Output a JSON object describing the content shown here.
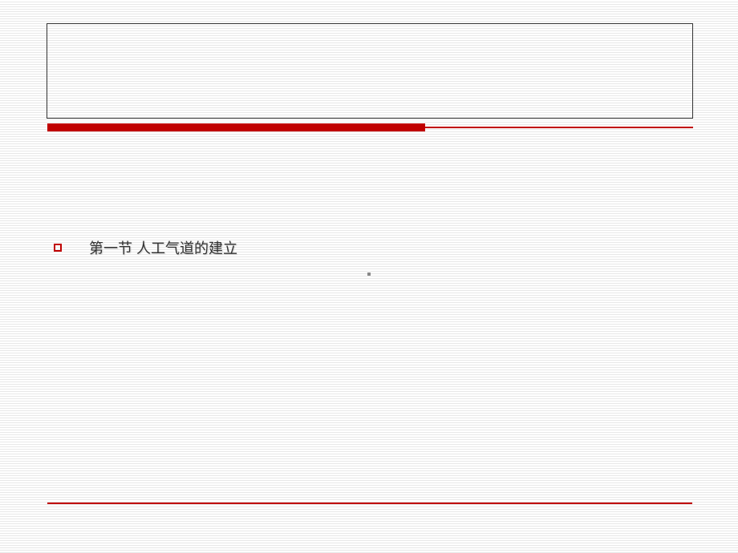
{
  "slide": {
    "bullet_text": "第一节 人工气道的建立"
  }
}
